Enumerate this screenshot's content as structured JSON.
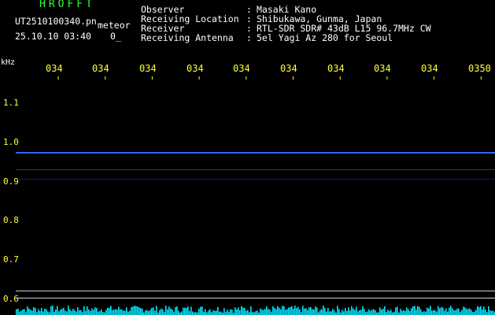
{
  "app_title": "HROFFT",
  "filename": "UT2510100340.pn",
  "meteor_label": "meteor",
  "datetime": "25.10.10 03:40",
  "meteor_count": "0_",
  "info": [
    {
      "label": "Observer",
      "value": "Masaki Kano"
    },
    {
      "label": "Receiving Location",
      "value": "Shibukawa, Gunma, Japan"
    },
    {
      "label": "Receiver",
      "value": "RTL-SDR SDR# 43dB L15 96.7MHz CW"
    },
    {
      "label": "Receiving Antenna",
      "value": "5el Yagi Az 280 for Seoul"
    }
  ],
  "colon": ":",
  "y_unit": "kHz",
  "y_ticks": [
    "1.1",
    "1.0",
    "0.9",
    "0.8",
    "0.7",
    "0.6"
  ],
  "x_ticks": [
    "034",
    "034",
    "034",
    "034",
    "034",
    "034",
    "034",
    "034",
    "034",
    "0350"
  ],
  "colors": {
    "background": "#000000",
    "header_text": "#ffffff",
    "label_text": "#ffff33",
    "title_text": "#33ff33",
    "signal_line": "#3366ff",
    "noise_floor": "#00e5ff",
    "baseline": "#cfcfcf"
  }
}
